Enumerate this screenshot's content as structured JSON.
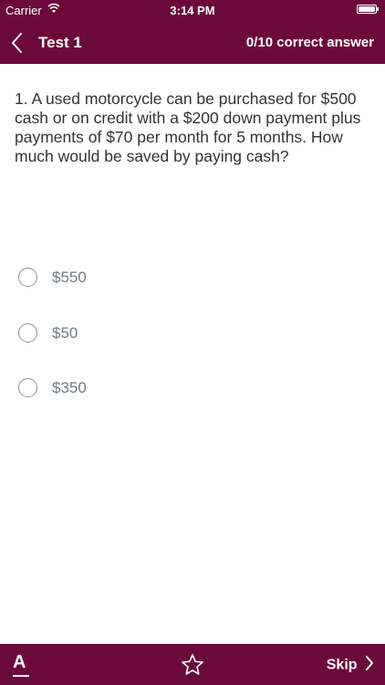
{
  "status_bar": {
    "carrier": "Carrier",
    "time": "3:14 PM"
  },
  "nav": {
    "title": "Test 1",
    "score": "0/10 correct answer"
  },
  "question": {
    "text": "1. A used motorcycle can be purchased for $500 cash or on credit with a $200 down payment plus payments of $70 per month for 5 months. How much would be saved by paying cash?"
  },
  "options": [
    {
      "label": "$550"
    },
    {
      "label": "$50"
    },
    {
      "label": "$350"
    }
  ],
  "bottom_bar": {
    "font_label": "A",
    "skip_label": "Skip"
  },
  "colors": {
    "brand": "#6b0a3a",
    "text": "#333333",
    "option_text": "#6f7a86"
  },
  "icons": {
    "back": "chevron-left-icon",
    "favorite": "star-icon",
    "skip": "chevron-right-icon",
    "wifi": "wifi-icon",
    "battery": "battery-icon"
  }
}
